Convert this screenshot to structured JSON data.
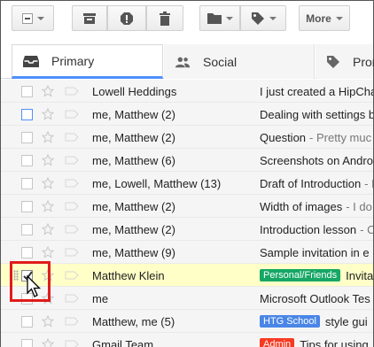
{
  "toolbar": {
    "more_label": "More"
  },
  "tabs": [
    {
      "label": "Primary",
      "icon": "inbox-icon"
    },
    {
      "label": "Social",
      "icon": "people-icon"
    },
    {
      "label": "Prom",
      "icon": "tag-icon"
    }
  ],
  "emails": [
    {
      "sender": "Lowell Heddings",
      "subject": "I just created a HipCha",
      "snippet": "",
      "label": "",
      "checked": false,
      "blue_checkbox": false,
      "highlight": false
    },
    {
      "sender": "me, Matthew (2)",
      "subject": "Dealing with settings b",
      "snippet": "",
      "label": "",
      "checked": false,
      "blue_checkbox": true,
      "highlight": false
    },
    {
      "sender": "me, Matthew (2)",
      "subject": "Question",
      "snippet": "- Pretty muc",
      "label": "",
      "checked": false,
      "blue_checkbox": false,
      "highlight": false
    },
    {
      "sender": "me, Matthew (6)",
      "subject": "Screenshots on Andro",
      "snippet": "",
      "label": "",
      "checked": false,
      "blue_checkbox": false,
      "highlight": false
    },
    {
      "sender": "me, Lowell, Matthew (13)",
      "subject": "Draft of Introduction",
      "snippet": "- N",
      "label": "",
      "checked": false,
      "blue_checkbox": false,
      "highlight": false
    },
    {
      "sender": "me, Matthew (2)",
      "subject": "Width of images",
      "snippet": "- I do",
      "label": "",
      "checked": false,
      "blue_checkbox": false,
      "highlight": false
    },
    {
      "sender": "me, Matthew (2)",
      "subject": "Introduction lesson",
      "snippet": "- C",
      "label": "",
      "checked": false,
      "blue_checkbox": false,
      "highlight": false
    },
    {
      "sender": "me, Matthew (9)",
      "subject": "Sample invitation in e",
      "snippet": "",
      "label": "",
      "checked": false,
      "blue_checkbox": false,
      "highlight": false
    },
    {
      "sender": "Matthew Klein",
      "subject": "Invita",
      "snippet": "",
      "label": "Personal/Friends",
      "label_color": "#16a765",
      "checked": true,
      "blue_checkbox": false,
      "highlight": true
    },
    {
      "sender": "me",
      "subject": "Microsoft Outlook Tes",
      "snippet": "",
      "label": "",
      "checked": false,
      "blue_checkbox": false,
      "highlight": false
    },
    {
      "sender": "Matthew, me (5)",
      "subject": "style gui",
      "snippet": "",
      "label": "HTG School",
      "label_color": "#4986e7",
      "checked": false,
      "blue_checkbox": false,
      "highlight": false
    },
    {
      "sender": "Gmail Team",
      "subject": "Tips for using",
      "snippet": "",
      "label": "Admin",
      "label_color": "#f83a22",
      "checked": false,
      "blue_checkbox": false,
      "highlight": false
    }
  ],
  "colors": {
    "tab_accent": "#4d90fe",
    "highlight_row": "#ffffc7",
    "callout_box": "#e01b1b"
  }
}
